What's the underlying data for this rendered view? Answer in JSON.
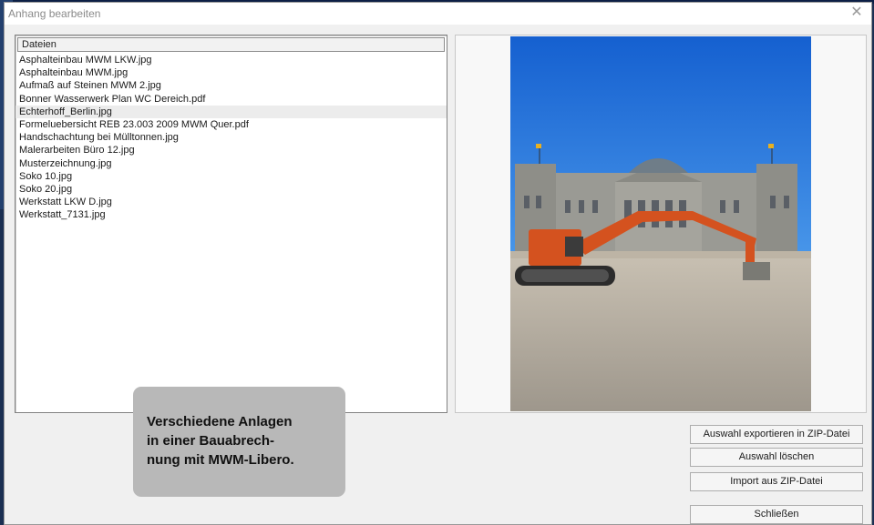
{
  "window": {
    "title": "Anhang bearbeiten",
    "close_glyph": "✕"
  },
  "filelist": {
    "header": "Dateien",
    "selected_index": 4,
    "items": [
      "Asphalteinbau MWM LKW.jpg",
      "Asphalteinbau MWM.jpg",
      "Aufmaß auf Steinen MWM 2.jpg",
      "Bonner Wasserwerk Plan WC Dereich.pdf",
      "Echterhoff_Berlin.jpg",
      "Formeluebersicht REB 23.003 2009 MWM Quer.pdf",
      "Handschachtung bei Mülltonnen.jpg",
      "Malerarbeiten Büro 12.jpg",
      "Musterzeichnung.jpg",
      "Soko 10.jpg",
      "Soko 20.jpg",
      "Werkstatt LKW D.jpg",
      "Werkstatt_7131.jpg"
    ]
  },
  "preview": {
    "icon": "photo-reichstag-excavator"
  },
  "buttons": {
    "export_zip": "Auswahl exportieren in ZIP-Datei",
    "delete_selection": "Auswahl löschen",
    "import_zip": "Import aus ZIP-Datei",
    "close": "Schließen"
  },
  "callout": {
    "lines": [
      "Verschiedene Anlagen",
      "in einer Bauabrech-",
      "nung mit MWM-Libero."
    ]
  },
  "colors": {
    "sky": "#1f6fd6",
    "excavator": "#d4521f",
    "ground": "#b3aa9c"
  }
}
